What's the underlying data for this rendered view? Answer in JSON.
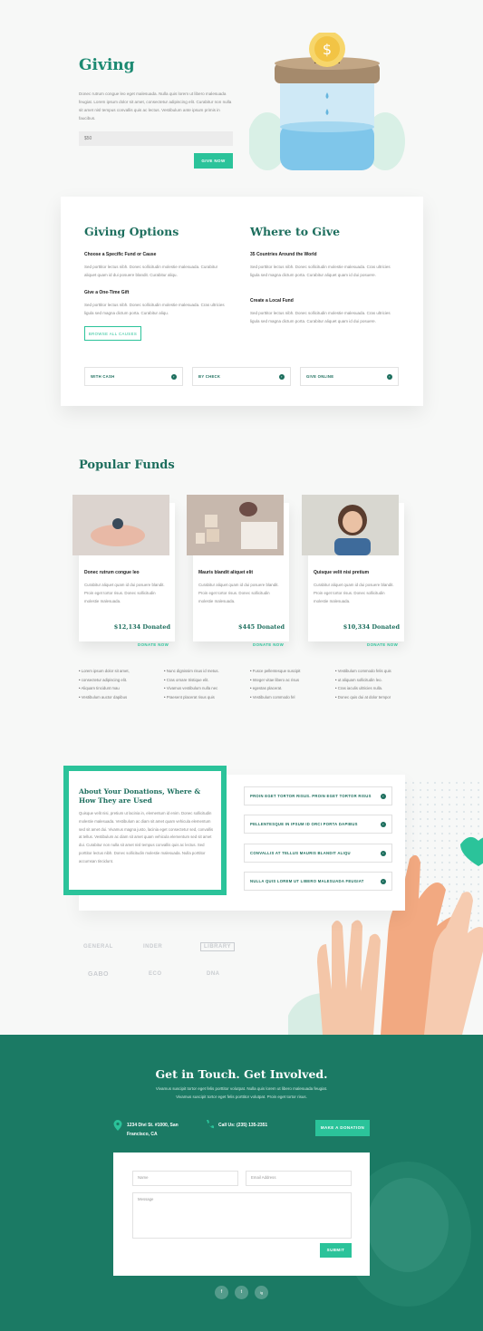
{
  "hero": {
    "title": "Giving",
    "text": "Donec rutrum congue leo eget malesuada. Nulla quis lorem ut libero malesuada feugiat. Lorem ipsum dolor sit amet, consectetur adipiscing elit. Curabitur non nulla sit amet nisl tempus convallis quis ac lectus. Vestibulum ante ipsum primis in faucibus.",
    "amount_value": "$50",
    "give_button": "GIVE NOW"
  },
  "options": {
    "title": "Giving Options",
    "item1_title": "Choose a Specific Fund or Cause",
    "item1_text": "Sed porttitor lectus nibh. Donec sollicitudin molestie malesuada. Curabitur aliquet quam id dui posuere blandit. Curabitur aliqu.",
    "item2_title": "Give a One-Time Gift",
    "item2_text": "Sed porttitor lectus nibh. Donec sollicitudin molestie malesuada. Cras ultricies ligula sed magna dictum porta. Curabitur aliqu.",
    "browse_button": "BROWSE ALL CAUSES"
  },
  "where": {
    "title": "Where to Give",
    "item1_title": "35 Countries Around the World",
    "item1_text": "Sed porttitor lectus nibh. Donec sollicitudin molestie malesuada. Cras ultricies ligula sed magna dictum porta. Curabitur aliquet quam id dui posuere.",
    "item2_title": "Create a Local Fund",
    "item2_text": "Sed porttitor lectus nibh. Donec sollicitudin molestie malesuada. Cras ultricies ligula sed magna dictum porta. Curabitur aliquet quam id dui posuere."
  },
  "pay_methods": [
    "WITH CASH",
    "BY CHECK",
    "GIVE ONLINE"
  ],
  "funds": {
    "title": "Popular Funds",
    "cards": [
      {
        "title": "Donec rutrum congue leo",
        "text": "Curabitur aliquet quam id dui posuere blandit. Proin eget tortor risus. Donec sollicitudin molestie malesuada.",
        "amount": "$12,134 Donated",
        "cta": "DONATE NOW"
      },
      {
        "title": "Mauris blandit aliquet elit",
        "text": "Curabitur aliquet quam id dui posuere blandit. Proin eget tortor risus. Donec sollicitudin molestie malesuada.",
        "amount": "$445 Donated",
        "cta": "DONATE NOW"
      },
      {
        "title": "Quisque velit nisi pretium",
        "text": "Curabitur aliquet quam id dui posuere blandit. Proin eget tortor risus. Donec sollicitudin molestie malesuada.",
        "amount": "$10,334 Donated",
        "cta": "DONATE NOW"
      }
    ],
    "bullets": [
      [
        "Lorem ipsum dolor sit amet,",
        "consectetur adipiscing elit.",
        "Aliquam tincidunt mau",
        "Vestibulum auctor dapibus"
      ],
      [
        "Nunc dignissim risus id metus.",
        "Cras ornare tristique elit.",
        "Vivamus vestibulum nulla nec",
        "Praesent placerat risus quis"
      ],
      [
        "Fusce pellentesque suscipit",
        "Integer vitae libero ac risus",
        "egestas placerat.",
        "Vestibulum commodo fel"
      ],
      [
        "Vestibulum commodo felis quis",
        "ut aliquam sollicitudin leo.",
        "Cras iaculis ultricies nulla.",
        "Donec quis dui at dolor tempor"
      ]
    ]
  },
  "about": {
    "title": "About Your Donations, Where & How They are Used",
    "text": "Quisque velit nisi, pretium ut lacinia in, elementum id enim. Donec sollicitudin molestie malesuada. Vestibulum ac diam sit amet quam vehicula elementum sed sit amet dui. Vivamus magna justo, lacinia eget consectetur sed, convallis at tellus. Vestibulum ac diam sit amet quam vehicula elementum sed sit amet dui. Curabitur non nulla sit amet nisl tempus convallis quis ac lectus. Sed porttitor lectus nibh. Donec sollicitudin molestie malesuada. Nulla porttitor accumsan tincidunt.",
    "accordion": [
      "PROIN EGET TORTOR RISUS. PROIN EGET TORTOR RISUS",
      "PELLENTESQUE IN IPSUM ID ORCI PORTA DAPIBUS",
      "CONVALLIS AT TELLUS MAURIS BLANDIT ALIQU",
      "NULLA QUIS LOREM UT LIBERO MALESUADA FEUGIAT"
    ]
  },
  "logos": [
    "GENERAL",
    "INDER",
    "LIBRARY",
    "GABO",
    "ECO",
    "DNA"
  ],
  "footer": {
    "title": "Get in Touch. Get Involved.",
    "text": "Vivamus suscipit tortor eget felis porttitor volutpat. Nulla quis lorem ut libero malesuada feugiat. Vivamus suscipit tortor eget felis porttitor volutpat. Proin eget tortor risus.",
    "address_line1": "1234 Divi St. #1000, San",
    "address_line2": "Francisco, CA",
    "phone": "Call Us: (235) 135-2351",
    "donation_button": "MAKE A DONATION",
    "name_placeholder": "Name",
    "email_placeholder": "Email Address",
    "message_placeholder": "Message",
    "submit": "SUBMIT",
    "social": [
      "f",
      "t",
      "ig"
    ]
  },
  "colors": {
    "accent": "#2bc39a",
    "primary": "#1c6e5d",
    "footer": "#1b7a64"
  }
}
